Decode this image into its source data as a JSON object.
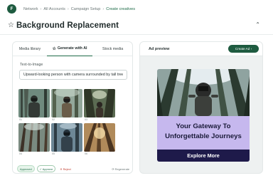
{
  "nav": {
    "logo_letter": "F",
    "breadcrumbs": [
      "Network",
      "All Accounts",
      "Campaign Setup",
      "Create creatives"
    ]
  },
  "header": {
    "title": "Background Replacement"
  },
  "left_panel": {
    "tabs": [
      {
        "label": "Media library"
      },
      {
        "label": "Generate with AI"
      },
      {
        "label": "Stock media"
      }
    ],
    "active_tab": "Generate with AI",
    "text_to_image_label": "Text-to-Image",
    "prompt_value": "Upward-looking person with camera surrounded by tall trees",
    "thumbnails": [
      {
        "caption": "01"
      },
      {
        "caption": "02"
      },
      {
        "caption": "03"
      },
      {
        "caption": "04"
      },
      {
        "caption": "05"
      },
      {
        "caption": "06"
      }
    ],
    "approved_badge": "Approved",
    "approve_label": "✓ Approve",
    "reject_label": "✕ Reject",
    "regenerate_label": "⟳ Regenerate"
  },
  "right_panel": {
    "ad_preview_label": "Ad preview",
    "create_ad_label": "Create Ad ›",
    "ad": {
      "headline_line1": "Your Gateway To",
      "headline_line2": "Unforgettable Journeys",
      "cta": "Explore More"
    }
  },
  "colors": {
    "brand_green": "#1e5b40",
    "ad_background": "#c6b8ee",
    "ad_cta_background": "#1e1a4a"
  }
}
